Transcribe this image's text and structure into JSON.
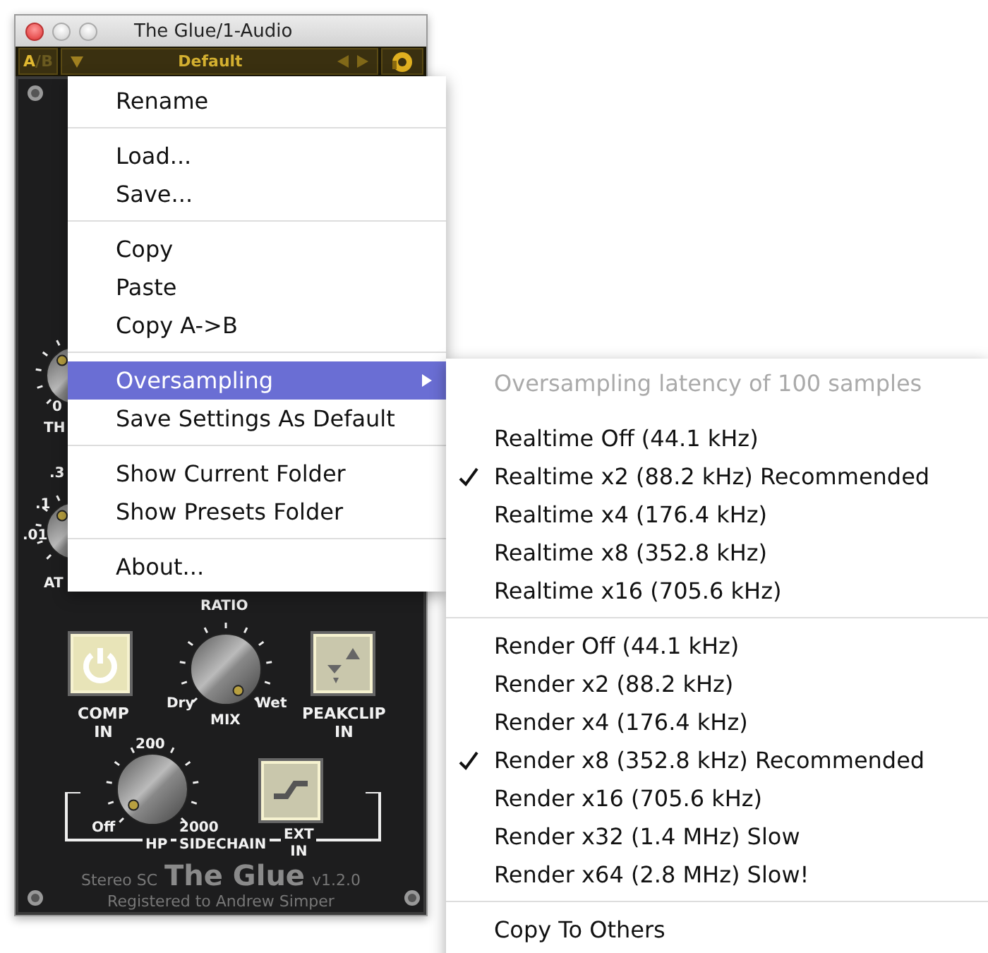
{
  "window": {
    "title": "The Glue/1-Audio"
  },
  "toolbar": {
    "ab": [
      {
        "label": "A",
        "selected": true
      },
      {
        "label": "B",
        "selected": false
      }
    ],
    "ab_separator": "/",
    "preset": "Default"
  },
  "panel": {
    "left_labels": [
      {
        "text": "0"
      },
      {
        "text": "TH"
      },
      {
        "text": ".3"
      },
      {
        "text": ".1"
      },
      {
        "text": ".01"
      },
      {
        "text": "AT"
      }
    ],
    "ratio_label": "RATIO",
    "comp": {
      "label_lines": [
        "COMP",
        "IN"
      ],
      "on": true
    },
    "mix": {
      "label": "MIX",
      "min_label": "Dry",
      "max_label": "Wet"
    },
    "peakclip": {
      "label_lines": [
        "PEAKCLIP",
        "IN"
      ],
      "on": false
    },
    "hp": {
      "top_label": "200",
      "min_label": "Off",
      "max_label": "2000"
    },
    "sidechain": {
      "hp_label": "HP",
      "label": "SIDECHAIN",
      "ext_lines": [
        "EXT",
        "IN"
      ]
    },
    "footer": {
      "variant": "Stereo SC",
      "name": "The Glue",
      "version": "v1.2.0",
      "registration": "Registered to Andrew Simper"
    }
  },
  "menu": {
    "groups": [
      [
        {
          "label": "Rename",
          "highlighted": false,
          "submenu": false
        }
      ],
      [
        {
          "label": "Load...",
          "highlighted": false,
          "submenu": false
        },
        {
          "label": "Save...",
          "highlighted": false,
          "submenu": false
        }
      ],
      [
        {
          "label": "Copy",
          "highlighted": false,
          "submenu": false
        },
        {
          "label": "Paste",
          "highlighted": false,
          "submenu": false
        },
        {
          "label": "Copy A->B",
          "highlighted": false,
          "submenu": false
        }
      ],
      [
        {
          "label": "Oversampling",
          "highlighted": true,
          "submenu": true
        },
        {
          "label": "Save Settings As Default",
          "highlighted": false,
          "submenu": false
        }
      ],
      [
        {
          "label": "Show Current Folder",
          "highlighted": false,
          "submenu": false
        },
        {
          "label": "Show Presets Folder",
          "highlighted": false,
          "submenu": false
        }
      ],
      [
        {
          "label": "About...",
          "highlighted": false,
          "submenu": false
        }
      ]
    ]
  },
  "submenu": {
    "header": "Oversampling latency of 100 samples",
    "groups": [
      [
        {
          "label": "Realtime Off (44.1 kHz)",
          "checked": false
        },
        {
          "label": "Realtime x2 (88.2 kHz) Recommended",
          "checked": true
        },
        {
          "label": "Realtime x4 (176.4 kHz)",
          "checked": false
        },
        {
          "label": "Realtime x8 (352.8 kHz)",
          "checked": false
        },
        {
          "label": "Realtime x16 (705.6 kHz)",
          "checked": false
        }
      ],
      [
        {
          "label": "Render Off (44.1 kHz)",
          "checked": false
        },
        {
          "label": "Render x2 (88.2 kHz)",
          "checked": false
        },
        {
          "label": "Render x4 (176.4 kHz)",
          "checked": false
        },
        {
          "label": "Render x8 (352.8 kHz) Recommended",
          "checked": true
        },
        {
          "label": "Render x16 (705.6 kHz)",
          "checked": false
        },
        {
          "label": "Render x32 (1.4 MHz) Slow",
          "checked": false
        },
        {
          "label": "Render x64 (2.8 MHz) Slow!",
          "checked": false
        }
      ],
      [
        {
          "label": "Copy To Others",
          "checked": false
        }
      ]
    ]
  }
}
